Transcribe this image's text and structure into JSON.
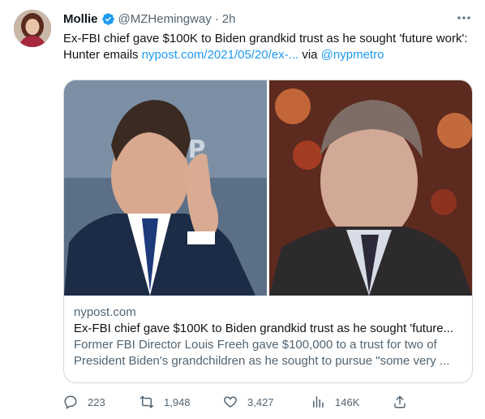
{
  "tweet": {
    "display_name": "Mollie",
    "handle": "@MZHemingway",
    "separator": "·",
    "time": "2h",
    "text_main": "Ex-FBI chief gave $100K to Biden grandkid trust as he sought 'future work': Hunter emails ",
    "text_link": "nypost.com/2021/05/20/ex-...",
    "text_via": " via ",
    "text_mention": "@nypmetro"
  },
  "card": {
    "domain": "nypost.com",
    "title": "Ex-FBI chief gave $100K to Biden grandkid trust as he sought 'future...",
    "description": "Former FBI Director Louis Freeh gave $100,000 to a trust for two of President Biden's grandchildren as he sought to pursue \"some very ..."
  },
  "actions": {
    "replies": "223",
    "retweets": "1,948",
    "likes": "3,427",
    "views": "146K"
  },
  "colors": {
    "accent": "#1d9bf0",
    "secondary_text": "#536471",
    "border": "#cfd9de"
  },
  "icons": [
    "verified-badge-icon",
    "more-icon",
    "reply-icon",
    "retweet-icon",
    "like-icon",
    "views-icon",
    "share-icon"
  ]
}
